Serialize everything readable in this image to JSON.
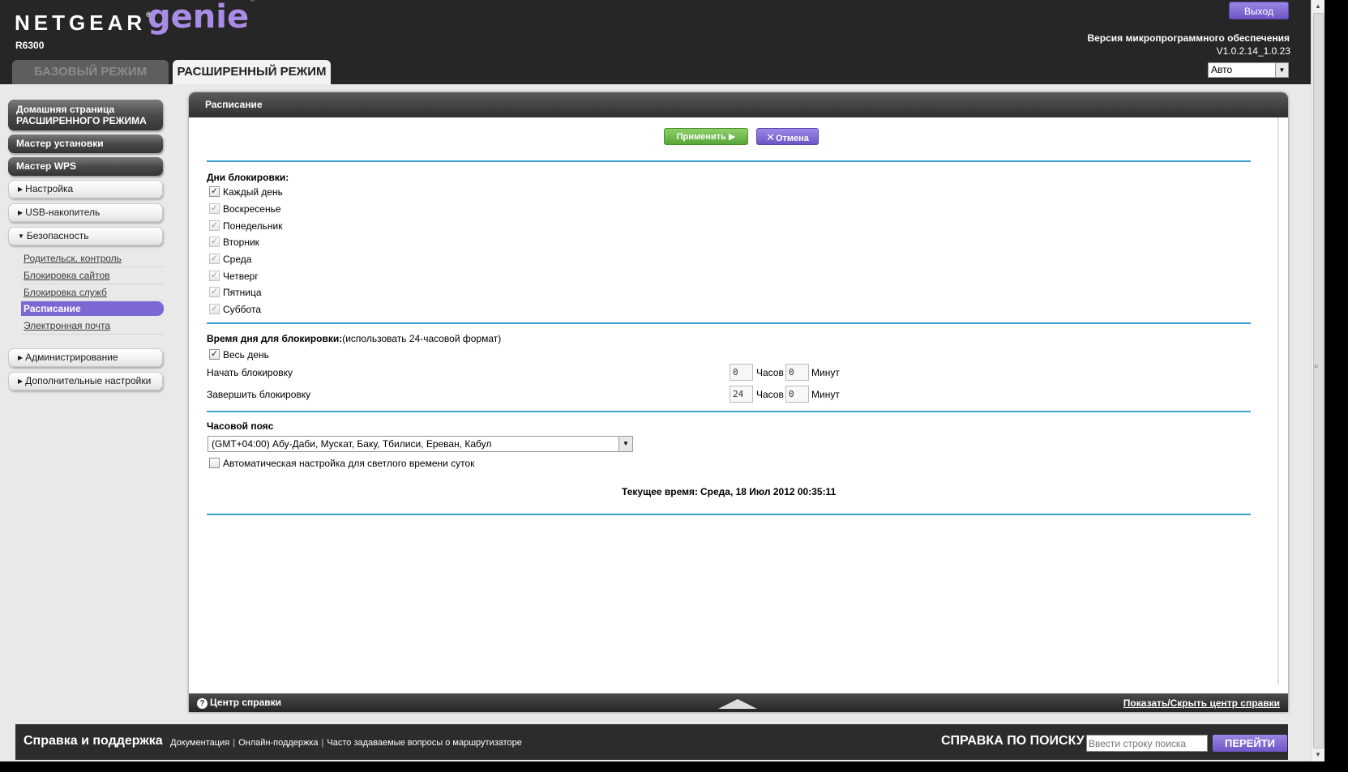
{
  "header": {
    "brand": "NETGEAR",
    "brand_reg": "®",
    "product": "genie",
    "product_tm": "™",
    "model": "R6300",
    "tabs": [
      {
        "label": "БАЗОВЫЙ РЕЖИМ",
        "active": false
      },
      {
        "label": "РАСШИРЕННЫЙ РЕЖИМ",
        "active": true
      }
    ],
    "logout_label": "Выход",
    "firmware_label": "Версия микропрограммного обеспечения",
    "firmware_version": "V1.0.2.14_1.0.23",
    "language": "Авто"
  },
  "sidebar": {
    "primary": [
      {
        "label": "Домашняя страница РАСШИРЕННОГО РЕЖИМА"
      },
      {
        "label": "Мастер установки"
      },
      {
        "label": "Мастер WPS"
      }
    ],
    "groups": [
      {
        "label": "Настройка",
        "expanded": false
      },
      {
        "label": "USB-накопитель",
        "expanded": false
      },
      {
        "label": "Безопасность",
        "expanded": true
      },
      {
        "label": "Администрирование",
        "expanded": false
      },
      {
        "label": "Дополнительные настройки",
        "expanded": false
      }
    ],
    "security_items": [
      {
        "label": "Родительск. контроль",
        "active": false
      },
      {
        "label": "Блокировка сайтов",
        "active": false
      },
      {
        "label": "Блокировка служб",
        "active": false
      },
      {
        "label": "Расписание",
        "active": true
      },
      {
        "label": "Электронная почта",
        "active": false
      }
    ]
  },
  "main": {
    "title": "Расписание",
    "apply_label": "Применить ▶",
    "cancel_label": "Отмена",
    "days_title": "Дни блокировки:",
    "days": [
      {
        "label": "Каждый день",
        "checked": true,
        "disabled": false
      },
      {
        "label": "Воскресенье",
        "checked": true,
        "disabled": true
      },
      {
        "label": "Понедельник",
        "checked": true,
        "disabled": true
      },
      {
        "label": "Вторник",
        "checked": true,
        "disabled": true
      },
      {
        "label": "Среда",
        "checked": true,
        "disabled": true
      },
      {
        "label": "Четверг",
        "checked": true,
        "disabled": true
      },
      {
        "label": "Пятница",
        "checked": true,
        "disabled": true
      },
      {
        "label": "Суббота",
        "checked": true,
        "disabled": true
      }
    ],
    "time_title": "Время дня для блокировки:",
    "time_note": "(использовать 24-часовой формат)",
    "all_day_label": "Весь день",
    "all_day_checked": true,
    "start_label": "Начать блокировку",
    "start_hour": "0",
    "start_minute": "0",
    "end_label": "Завершить блокировку",
    "end_hour": "24",
    "end_minute": "0",
    "hours_unit": "Часов",
    "minutes_unit": "Минут",
    "timezone_title": "Часовой пояс",
    "timezone_value": "(GMT+04:00) Абу-Даби, Мускат, Баку, Тбилиси, Ереван, Кабул",
    "dst_label": "Автоматическая настройка для светлого времени суток",
    "dst_checked": false,
    "current_time_label": "Текущее время:",
    "current_time_value": "Среда, 18 Июл 2012 00:35:11"
  },
  "help_bar": {
    "left_label": "Центр справки",
    "right_label": "Показать/Скрыть центр справки"
  },
  "footer": {
    "title": "Справка и поддержка",
    "links": [
      "Документация",
      "Онлайн-поддержка",
      "Часто задаваемые вопросы о маршрутизаторе"
    ],
    "search_label": "СПРАВКА ПО ПОИСКУ",
    "search_placeholder": "Ввести строку поиска",
    "go_label": "ПЕРЕЙТИ"
  }
}
